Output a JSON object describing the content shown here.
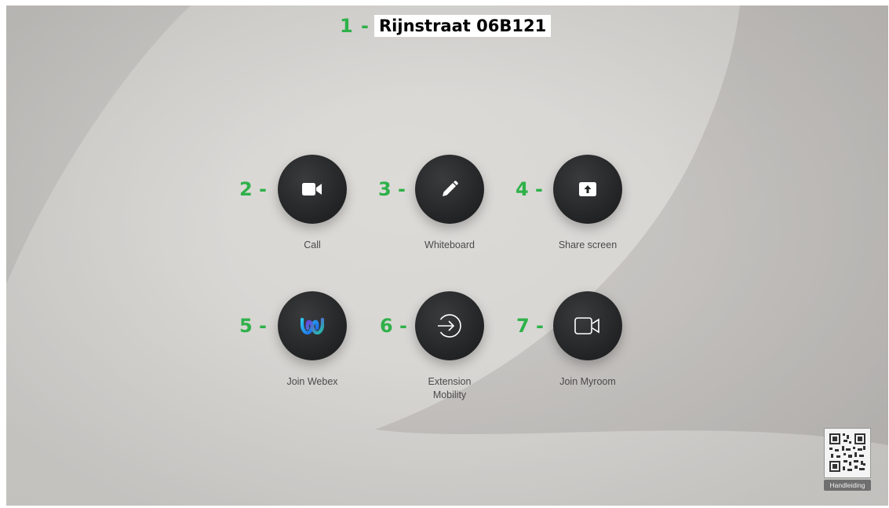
{
  "header": {
    "number": "1 -",
    "room_name": "Rijnstraat 06B121"
  },
  "tiles": [
    {
      "number": "2 -",
      "label": "Call",
      "icon": "video-camera-icon"
    },
    {
      "number": "3 -",
      "label": "Whiteboard",
      "icon": "pencil-icon"
    },
    {
      "number": "4 -",
      "label": "Share screen",
      "icon": "share-screen-icon"
    },
    {
      "number": "5 -",
      "label": "Join Webex",
      "icon": "webex-logo-icon"
    },
    {
      "number": "6 -",
      "label": "Extension Mobility",
      "label_lines": [
        "Extension",
        "Mobility"
      ],
      "icon": "sign-in-arrow-icon"
    },
    {
      "number": "7 -",
      "label": "Join Myroom",
      "icon": "video-camera-outline-icon"
    }
  ],
  "qr": {
    "label": "Handleiding"
  },
  "colors": {
    "annotation_green": "#2fb14a",
    "button_dark": "#222325",
    "label_gray": "#4a4a4a"
  }
}
